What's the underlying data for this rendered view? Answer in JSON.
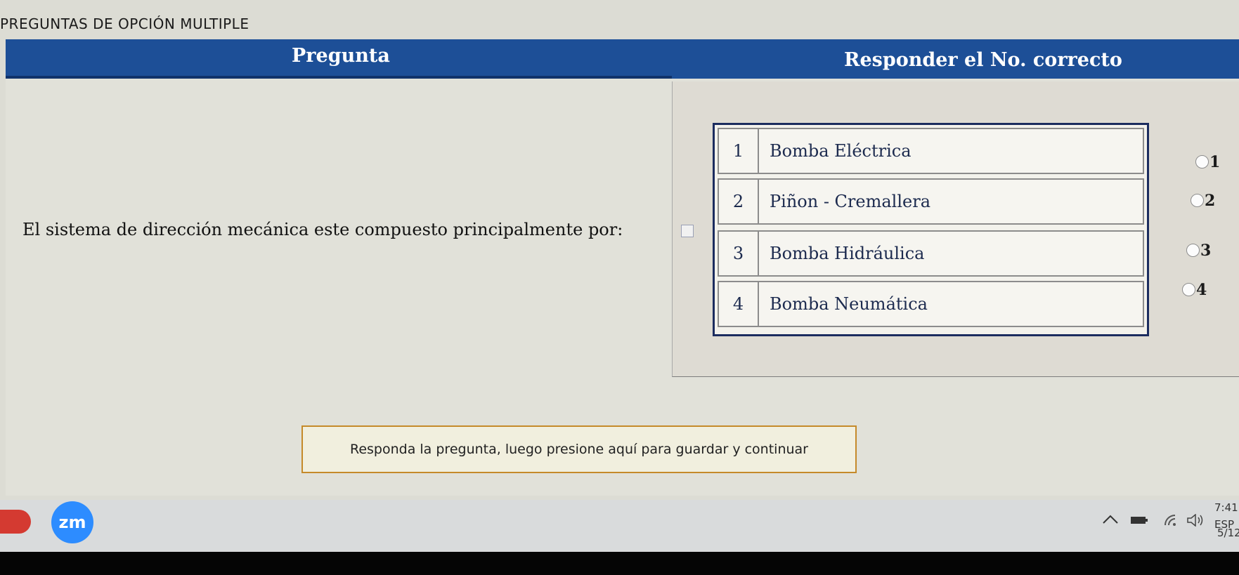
{
  "page": {
    "heading": "PREGUNTAS DE OPCIÓN MULTIPLE"
  },
  "header": {
    "question_col": "Pregunta",
    "answer_col": "Responder el No. correcto"
  },
  "question": {
    "text": "El sistema de dirección mecánica este compuesto principalmente por:"
  },
  "options": [
    {
      "number": "1",
      "label": "Bomba Eléctrica"
    },
    {
      "number": "2",
      "label": "Piñon - Cremallera"
    },
    {
      "number": "3",
      "label": "Bomba Hidráulica"
    },
    {
      "number": "4",
      "label": "Bomba Neumática"
    }
  ],
  "radio_options": [
    "1",
    "2",
    "3",
    "4"
  ],
  "save_button": {
    "label": "Responda la pregunta, luego presione aquí para guardar y continuar"
  },
  "taskbar": {
    "zoom_label": "zm",
    "language": "ESP",
    "time": "7:41",
    "date": "5/12"
  },
  "colors": {
    "header_bg": "#1d4f97",
    "button_border": "#c58a2a",
    "zoom_blue": "#2d8cff"
  }
}
